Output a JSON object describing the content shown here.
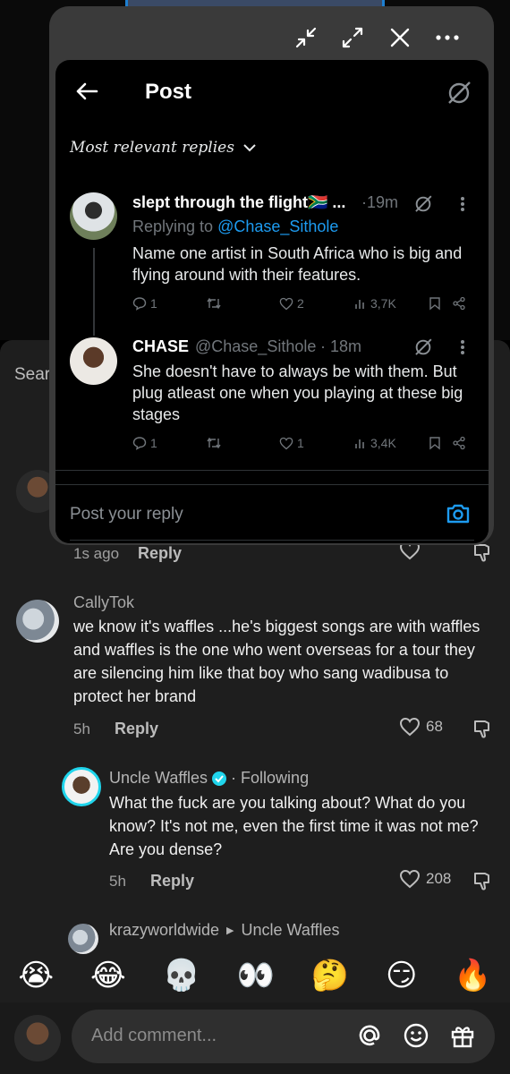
{
  "background": {
    "search_peek": "Sear",
    "partial_comment": {
      "time": "1s ago",
      "reply_label": "Reply"
    },
    "comments": [
      {
        "name": "CallyTok",
        "text": "we know it's waffles ...he's biggest songs are with waffles and waffles is the one who went overseas for a tour they are silencing him like that boy who sang wadibusa to protect her brand",
        "time": "5h",
        "reply_label": "Reply",
        "likes": "68"
      },
      {
        "name": "Uncle Waffles",
        "following": "· Following",
        "text": "What the fuck are you talking about? What do you know? It's not me, even the first time it was not me? Are you dense?",
        "time": "5h",
        "reply_label": "Reply",
        "likes": "208"
      },
      {
        "name": "krazyworldwide",
        "reply_to": "Uncle Waffles"
      }
    ],
    "emojis": [
      "😭",
      "😂",
      "💀",
      "👀",
      "🤔",
      "😏",
      "🔥"
    ],
    "comment_input_placeholder": "Add comment..."
  },
  "x_window": {
    "title": "Post",
    "sort_label": "Most relevant replies",
    "tweets": [
      {
        "name": "slept through the flight🇿🇦 ...",
        "time": "·19m",
        "replying_prefix": "Replying to ",
        "replying_handle": "@Chase_Sithole",
        "text": "Name one artist in South Africa who is big and flying around with their features.",
        "replies": "1",
        "likes": "2",
        "views": "3,7K"
      },
      {
        "name": "CHASE",
        "handle": "@Chase_Sithole",
        "time": "· 18m",
        "text": "She doesn't have to always be with them. But plug atleast one when you playing at these big stages",
        "replies": "1",
        "likes": "1",
        "views": "3,4K"
      }
    ],
    "reply_placeholder": "Post your reply"
  },
  "colors": {
    "x_link": "#1d9bf0",
    "tiktok_ring": "#20d5ec",
    "verified": "#20d5ec"
  }
}
